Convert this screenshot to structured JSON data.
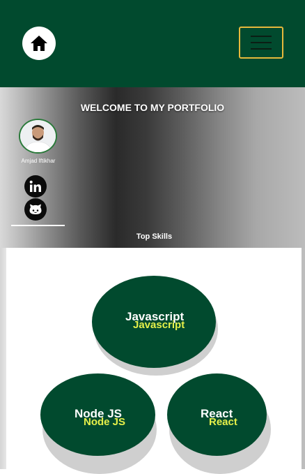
{
  "header": {
    "home_icon": "home-icon",
    "menu_icon": "hamburger-menu-icon",
    "colors": {
      "bar": "#014a2e",
      "menu_border": "#e7b93c"
    }
  },
  "hero": {
    "welcome": "WELCOME TO MY PORTFOLIO",
    "profile_name": "Amjad Iftikhar",
    "social_icons": [
      "linkedin-icon",
      "github-icon"
    ],
    "section_title": "Top Skills"
  },
  "skills": [
    {
      "label": "Javascript",
      "echo": "Javascript"
    },
    {
      "label": "Node JS",
      "echo": "Node JS"
    },
    {
      "label": "React",
      "echo": "React"
    }
  ],
  "colors": {
    "skill_green": "#014a2e",
    "skill_echo": "#e6f04a"
  }
}
